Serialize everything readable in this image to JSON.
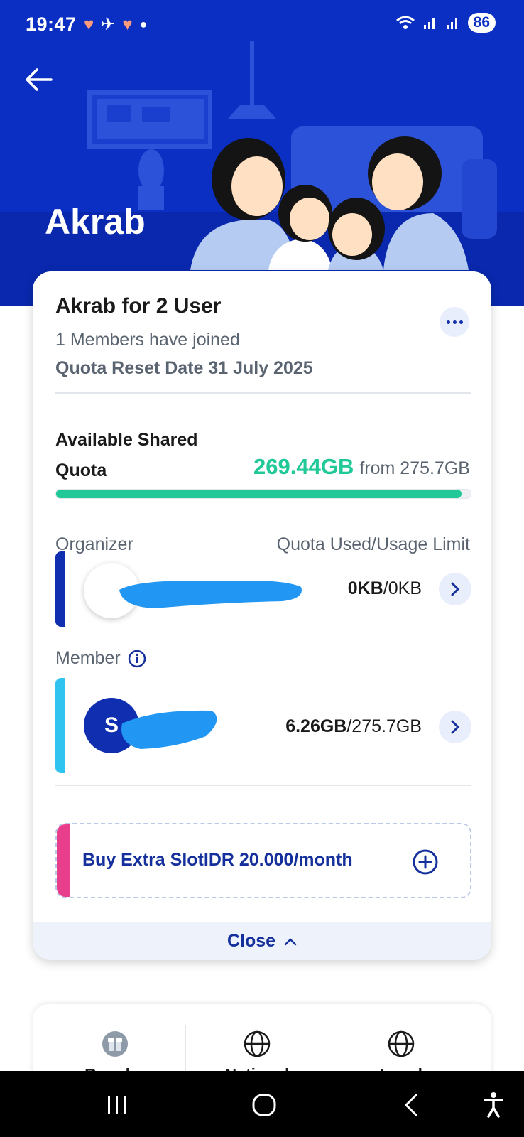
{
  "status_bar": {
    "time": "19:47",
    "battery": "86",
    "icons": [
      "heart-badge-icon",
      "bird-icon",
      "heart-badge-icon",
      "dot-icon",
      "wifi-icon",
      "signal-icon",
      "signal-icon"
    ]
  },
  "header": {
    "title": "Akrab",
    "back_icon": "arrow-left-icon"
  },
  "plan": {
    "name": "Akrab for 2 User",
    "members_joined": "1 Members have joined",
    "reset_date": "Quota Reset Date 31 July 2025"
  },
  "quota": {
    "label": "Available Shared Quota",
    "available": "269.44GB",
    "total_text": "from 275.7GB",
    "fraction_available": 0.977
  },
  "columns": {
    "organizer": "Organizer",
    "usage": "Quota Used/Usage Limit"
  },
  "organizer": {
    "used": "0KB",
    "limit": "/0KB"
  },
  "member": {
    "label": "Member",
    "initial": "S",
    "used": "6.26GB",
    "limit": "/275.7GB"
  },
  "buy_slot": {
    "label": "Buy Extra SlotIDR 20.000/month"
  },
  "close": {
    "label": "Close"
  },
  "bottom_tabs": [
    {
      "label": "Regular",
      "icon": "gift-icon"
    },
    {
      "label": "National",
      "icon": "globe-icon"
    },
    {
      "label": "Local",
      "icon": "globe-icon"
    }
  ],
  "colors": {
    "brand_blue": "#0a2fc2",
    "quota_green": "#20c997",
    "organizer_bar": "#0f2fb0",
    "member_bar": "#2ec4ef",
    "buy_pink": "#e83e8c"
  }
}
